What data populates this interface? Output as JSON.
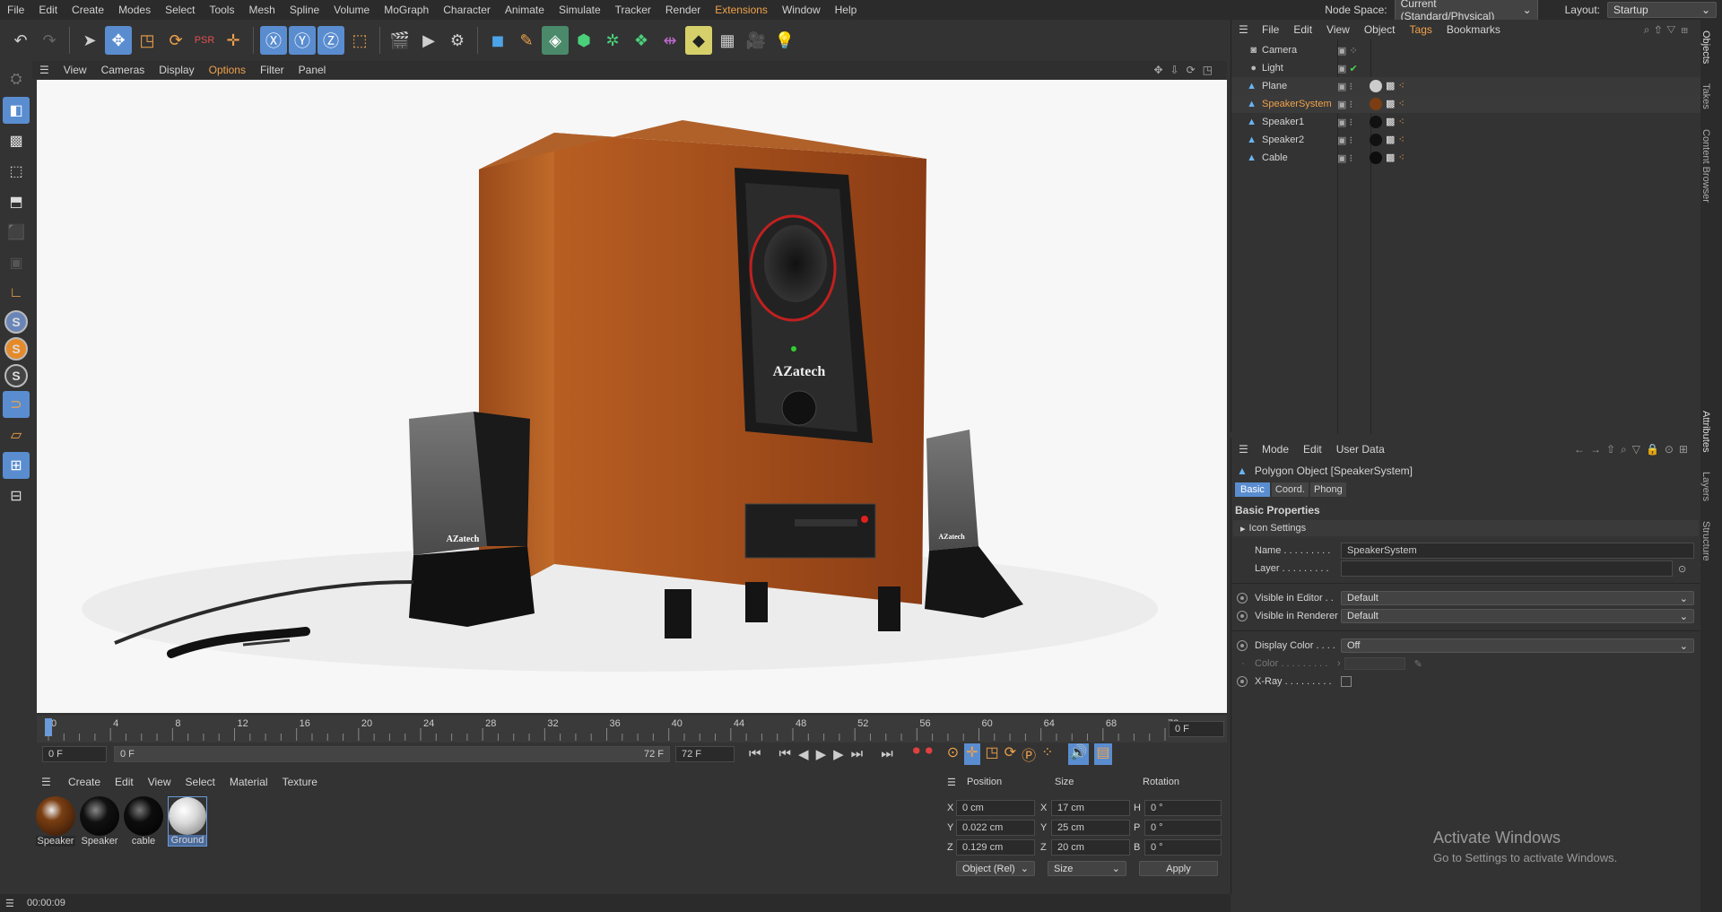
{
  "menubar": {
    "items": [
      "File",
      "Edit",
      "Create",
      "Modes",
      "Select",
      "Tools",
      "Mesh",
      "Spline",
      "Volume",
      "MoGraph",
      "Character",
      "Animate",
      "Simulate",
      "Tracker",
      "Render",
      "Extensions",
      "Window",
      "Help"
    ],
    "node_space_label": "Node Space:",
    "node_space_value": "Current (Standard/Physical)",
    "layout_label": "Layout:",
    "layout_value": "Startup"
  },
  "viewport_menu": [
    "View",
    "Cameras",
    "Display",
    "Options",
    "Filter",
    "Panel"
  ],
  "scene": {
    "subwoofer_brand": "AZatech",
    "left_speaker_brand": "AZatech",
    "right_speaker_brand": "AZatech"
  },
  "timeline": {
    "ticks": [
      "0",
      "4",
      "8",
      "12",
      "16",
      "20",
      "24",
      "28",
      "32",
      "36",
      "40",
      "44",
      "48",
      "52",
      "56",
      "60",
      "64",
      "68",
      "72"
    ],
    "current_frame": "0 F",
    "start_frame": "0 F",
    "range_start": "0 F",
    "range_end": "72 F",
    "end_frame": "72 F"
  },
  "material_menu": [
    "Create",
    "Edit",
    "View",
    "Select",
    "Material",
    "Texture"
  ],
  "materials": [
    {
      "label": "Speaker",
      "color": "#7a3e12"
    },
    {
      "label": "Speaker",
      "color": "#111111"
    },
    {
      "label": "cable",
      "color": "#0d0d0d"
    },
    {
      "label": "Ground",
      "color": "#d8d8d8"
    }
  ],
  "coords": {
    "headers": [
      "Position",
      "Size",
      "Rotation"
    ],
    "rows": [
      {
        "axis": "X",
        "pos": "0 cm",
        "saxis": "X",
        "size": "17 cm",
        "raxis": "H",
        "rot": "0 °"
      },
      {
        "axis": "Y",
        "pos": "0.022 cm",
        "saxis": "Y",
        "size": "25 cm",
        "raxis": "P",
        "rot": "0 °"
      },
      {
        "axis": "Z",
        "pos": "0.129 cm",
        "saxis": "Z",
        "size": "20 cm",
        "raxis": "B",
        "rot": "0 °"
      }
    ],
    "mode": "Object (Rel)",
    "size_mode": "Size",
    "apply": "Apply"
  },
  "status": {
    "time": "00:00:09"
  },
  "objects_menu": [
    "File",
    "Edit",
    "View",
    "Object",
    "Tags",
    "Bookmarks"
  ],
  "objects": [
    {
      "name": "Camera",
      "selected": false
    },
    {
      "name": "Light",
      "selected": false
    },
    {
      "name": "Plane",
      "selected": false
    },
    {
      "name": "SpeakerSystem",
      "selected": true
    },
    {
      "name": "Speaker1",
      "selected": false
    },
    {
      "name": "Speaker2",
      "selected": false
    },
    {
      "name": "Cable",
      "selected": false
    }
  ],
  "attributes": {
    "menu": [
      "Mode",
      "Edit",
      "User Data"
    ],
    "title": "Polygon Object [SpeakerSystem]",
    "tabs": [
      "Basic",
      "Coord.",
      "Phong"
    ],
    "section": "Basic Properties",
    "icon_settings": "Icon Settings",
    "name_label": "Name . . . . . . . . .",
    "name_value": "SpeakerSystem",
    "layer_label": "Layer . . . . . . . . .",
    "vis_editor_label": "Visible in Editor . .",
    "vis_editor_value": "Default",
    "vis_render_label": "Visible in Renderer",
    "vis_render_value": "Default",
    "display_color_label": "Display Color . . . .",
    "display_color_value": "Off",
    "color_label": "Color . . . . . . . . .",
    "xray_label": "X-Ray . . . . . . . . ."
  },
  "right_tabs": [
    "Objects",
    "Takes",
    "Content Browser",
    "Attributes",
    "Layers",
    "Structure"
  ],
  "watermark": {
    "title": "Activate Windows",
    "sub": "Go to Settings to activate Windows."
  }
}
